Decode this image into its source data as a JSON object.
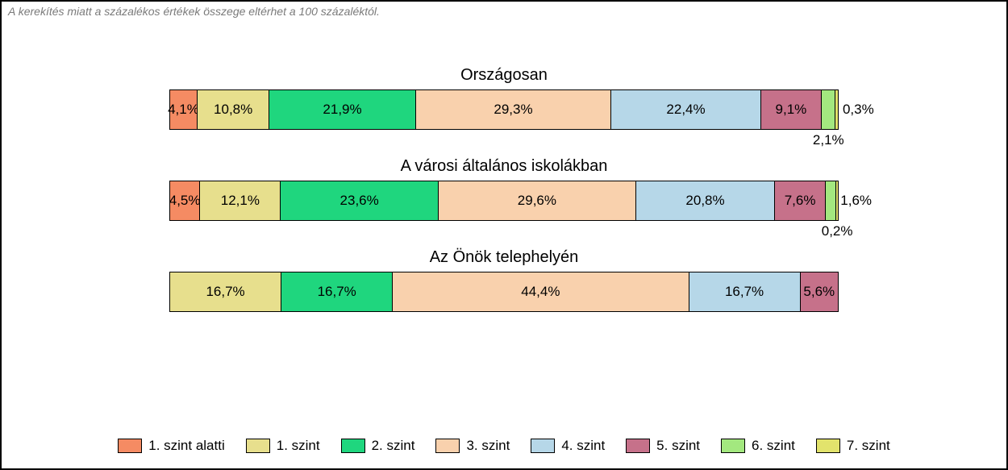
{
  "note": "A kerekítés miatt a százalékos értékek összege eltérhet a 100 százaléktól.",
  "legend": [
    {
      "label": "1. szint alatti",
      "cls": "c0"
    },
    {
      "label": "1. szint",
      "cls": "c1"
    },
    {
      "label": "2. szint",
      "cls": "c2"
    },
    {
      "label": "3. szint",
      "cls": "c3"
    },
    {
      "label": "4. szint",
      "cls": "c4"
    },
    {
      "label": "5. szint",
      "cls": "c5"
    },
    {
      "label": "6. szint",
      "cls": "c6"
    },
    {
      "label": "7. szint",
      "cls": "c7"
    }
  ],
  "rows": [
    {
      "title": "Országosan",
      "segs": [
        {
          "w": 4.1,
          "label": "4,1%",
          "cls": "c0",
          "in": true
        },
        {
          "w": 10.8,
          "label": "10,8%",
          "cls": "c1",
          "in": true
        },
        {
          "w": 21.9,
          "label": "21,9%",
          "cls": "c2",
          "in": true
        },
        {
          "w": 29.3,
          "label": "29,3%",
          "cls": "c3",
          "in": true
        },
        {
          "w": 22.4,
          "label": "22,4%",
          "cls": "c4",
          "in": true
        },
        {
          "w": 9.1,
          "label": "9,1%",
          "cls": "c5",
          "in": true
        },
        {
          "w": 2.1,
          "label": "2,1%",
          "cls": "c6",
          "in": false,
          "below": true
        },
        {
          "w": 0.3,
          "label": "0,3%",
          "cls": "c7",
          "in": false,
          "right": true
        }
      ]
    },
    {
      "title": "A városi általános iskolákban",
      "segs": [
        {
          "w": 4.5,
          "label": "4,5%",
          "cls": "c0",
          "in": true
        },
        {
          "w": 12.1,
          "label": "12,1%",
          "cls": "c1",
          "in": true
        },
        {
          "w": 23.6,
          "label": "23,6%",
          "cls": "c2",
          "in": true
        },
        {
          "w": 29.6,
          "label": "29,6%",
          "cls": "c3",
          "in": true
        },
        {
          "w": 20.8,
          "label": "20,8%",
          "cls": "c4",
          "in": true
        },
        {
          "w": 7.6,
          "label": "7,6%",
          "cls": "c5",
          "in": true
        },
        {
          "w": 1.6,
          "label": "1,6%",
          "cls": "c6",
          "in": false,
          "right": true
        },
        {
          "w": 0.2,
          "label": "0,2%",
          "cls": "c7",
          "in": false,
          "below": true
        }
      ]
    },
    {
      "title": "Az Önök telephelyén",
      "segs": [
        {
          "w": 16.7,
          "label": "16,7%",
          "cls": "c1",
          "in": true
        },
        {
          "w": 16.7,
          "label": "16,7%",
          "cls": "c2",
          "in": true
        },
        {
          "w": 44.4,
          "label": "44,4%",
          "cls": "c3",
          "in": true
        },
        {
          "w": 16.7,
          "label": "16,7%",
          "cls": "c4",
          "in": true
        },
        {
          "w": 5.6,
          "label": "5,6%",
          "cls": "c5",
          "in": true
        }
      ]
    }
  ],
  "chart_data": {
    "type": "bar",
    "stacked": true,
    "orientation": "horizontal",
    "unit": "%",
    "title": "",
    "note": "A kerekítés miatt a százalékos értékek összege eltérhet a 100 százaléktól.",
    "categories": [
      "Országosan",
      "A városi általános iskolákban",
      "Az Önök telephelyén"
    ],
    "series": [
      {
        "name": "1. szint alatti",
        "color": "#f58b63",
        "values": [
          4.1,
          4.5,
          0.0
        ]
      },
      {
        "name": "1. szint",
        "color": "#e7df8d",
        "values": [
          10.8,
          12.1,
          16.7
        ]
      },
      {
        "name": "2. szint",
        "color": "#1fd67e",
        "values": [
          21.9,
          23.6,
          16.7
        ]
      },
      {
        "name": "3. szint",
        "color": "#f9d1ad",
        "values": [
          29.3,
          29.6,
          44.4
        ]
      },
      {
        "name": "4. szint",
        "color": "#b6d7e8",
        "values": [
          22.4,
          20.8,
          16.7
        ]
      },
      {
        "name": "5. szint",
        "color": "#c6718a",
        "values": [
          9.1,
          7.6,
          5.6
        ]
      },
      {
        "name": "6. szint",
        "color": "#a3e87f",
        "values": [
          2.1,
          1.6,
          0.0
        ]
      },
      {
        "name": "7. szint",
        "color": "#e2e36c",
        "values": [
          0.3,
          0.2,
          0.0
        ]
      }
    ],
    "xlim": [
      0,
      100
    ]
  }
}
